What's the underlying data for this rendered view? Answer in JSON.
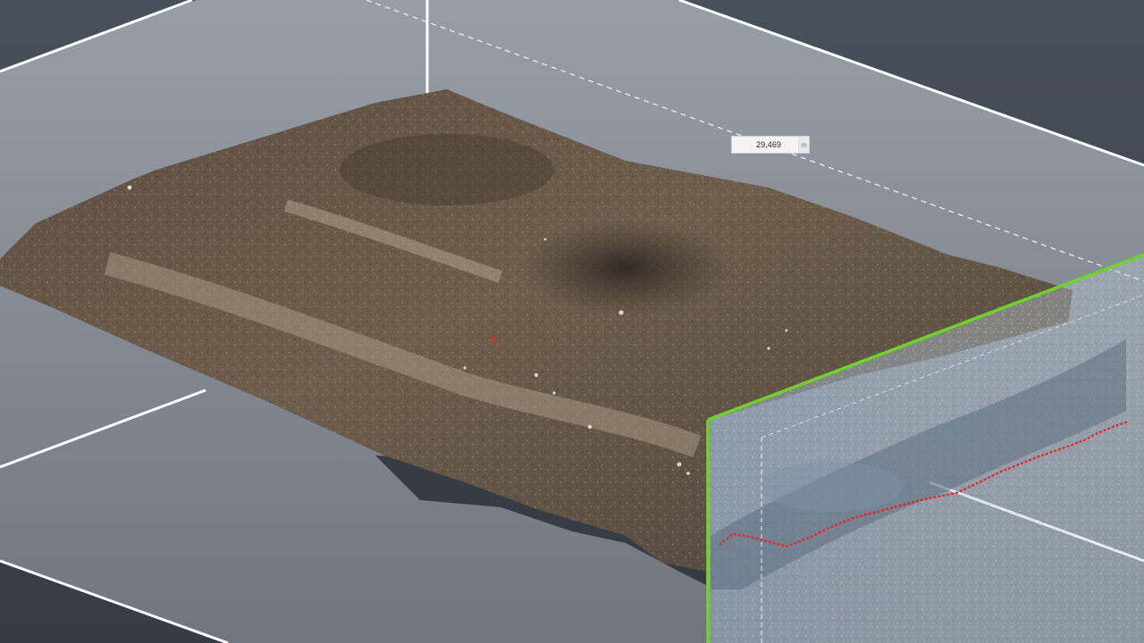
{
  "viewport": {
    "background_color": "#3f4750",
    "plane_color": "#7f8790",
    "grid_line_color": "#ffffff",
    "selection_box_color": "#6fd22a",
    "profile_line_color": "#e32626"
  },
  "measurement": {
    "value": "29,469",
    "unit": "m"
  },
  "point_cloud": {
    "type": "terrain-scan"
  }
}
